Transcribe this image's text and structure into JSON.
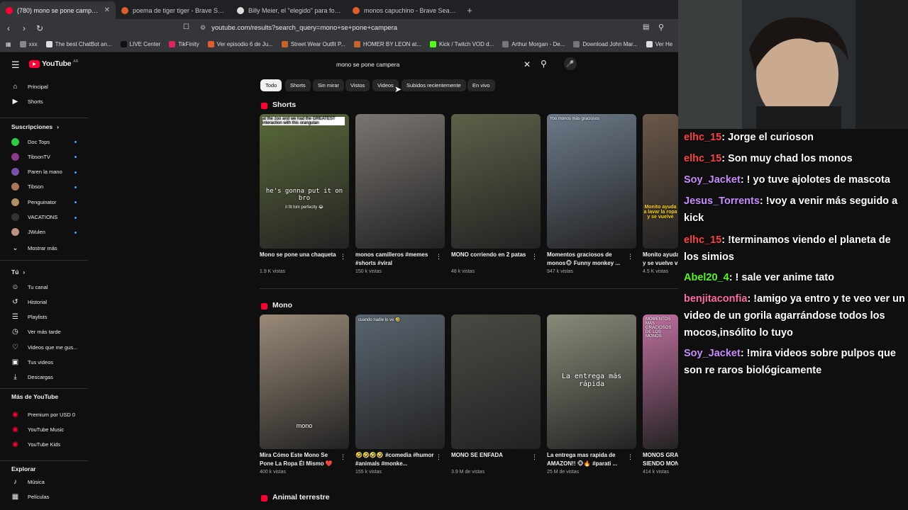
{
  "browser": {
    "tabs": [
      {
        "label": "(780) mono se pone campera - Y",
        "active": true,
        "color": "#ff0033"
      },
      {
        "label": "poema de tiger tiger - Brave Search",
        "active": false,
        "color": "#e25b2b"
      },
      {
        "label": "Billy Meier, el \"elegido\" para fotografi",
        "active": false,
        "color": "#dddddd"
      },
      {
        "label": "monos capuchino - Brave Search",
        "active": false,
        "color": "#e25b2b"
      }
    ],
    "url": "youtube.com/results?search_query=mono+se+pone+campera",
    "bookmarks": [
      {
        "label": "xxx",
        "color": "#888888"
      },
      {
        "label": "The best ChatBot an...",
        "color": "#dddddd"
      },
      {
        "label": "LIVE Center",
        "color": "#111111"
      },
      {
        "label": "TikFinity",
        "color": "#e0245e"
      },
      {
        "label": "Ver episodio 6 de Ju...",
        "color": "#e25b2b"
      },
      {
        "label": "Street Wear Outfit P...",
        "color": "#c8642a"
      },
      {
        "label": "HOMER BY LEON at...",
        "color": "#c8642a"
      },
      {
        "label": "Kick / Twitch VOD d...",
        "color": "#53fc18"
      },
      {
        "label": "Arthur Morgan - De...",
        "color": "#777777"
      },
      {
        "label": "Download John Mar...",
        "color": "#777777"
      },
      {
        "label": "Ver He",
        "color": "#dddddd"
      }
    ]
  },
  "youtube": {
    "logo": "YouTube",
    "logo_sup": "AR",
    "search_value": "mono se pone campera",
    "sidebar": {
      "main": [
        {
          "label": "Principal",
          "icon": "home-icon"
        },
        {
          "label": "Shorts",
          "icon": "shorts-icon"
        }
      ],
      "subs_heading": "Suscripciones",
      "subs": [
        {
          "label": "Doc Tops",
          "color": "#2ecc40"
        },
        {
          "label": "TibsonTV",
          "color": "#8b3a8b"
        },
        {
          "label": "Paren la mano",
          "color": "#7b4fb0"
        },
        {
          "label": "Tibson",
          "color": "#aa7755"
        },
        {
          "label": "Penguinator",
          "color": "#b09060"
        },
        {
          "label": "VACATIONS",
          "color": "#333333"
        },
        {
          "label": "JWulen",
          "color": "#c09080"
        }
      ],
      "show_more": "Mostrar más",
      "you_heading": "Tú",
      "you": [
        {
          "label": "Tu canal",
          "icon": "channel-icon"
        },
        {
          "label": "Historial",
          "icon": "history-icon"
        },
        {
          "label": "Playlists",
          "icon": "playlists-icon"
        },
        {
          "label": "Ver más tarde",
          "icon": "watch-later-icon"
        },
        {
          "label": "Videos que me gus...",
          "icon": "like-icon"
        },
        {
          "label": "Tus videos",
          "icon": "your-videos-icon"
        },
        {
          "label": "Descargas",
          "icon": "download-icon"
        }
      ],
      "more_heading": "Más de YouTube",
      "more": [
        {
          "label": "Premium por USD 0",
          "color": "#ff0033"
        },
        {
          "label": "YouTube Music",
          "color": "#ff0033"
        },
        {
          "label": "YouTube Kids",
          "color": "#ff0033"
        }
      ],
      "explore_heading": "Explorar",
      "explore": [
        {
          "label": "Música",
          "icon": "music-icon"
        },
        {
          "label": "Películas",
          "icon": "movies-icon"
        }
      ]
    },
    "chips": [
      "Todo",
      "Shorts",
      "Sin mirar",
      "Vistos",
      "Videos",
      "Subidos recientemente",
      "En vivo"
    ],
    "sections": [
      {
        "title": "Shorts",
        "items": [
          {
            "title": "Mono se pone una chaqueta",
            "views": "1.9 K vistas",
            "top_text": "at the zoo and we had the GREATEST interaction with this orangutan",
            "mid_text": "he's gonna put it on bro",
            "low_text": "it fit him perfectly 😂",
            "bg": "#5a6a3a"
          },
          {
            "title": "monos camilleros #memes #shorts #viral",
            "views": "150 k vistas",
            "top_text": "",
            "mid_text": "",
            "low_text": "",
            "bg": "#7a7570"
          },
          {
            "title": "MONO corriendo en 2 patas",
            "views": "48 k vistas",
            "top_text": "",
            "mid_text": "",
            "low_text": "",
            "bg": "#5d6148"
          },
          {
            "title": "Momentos graciosos de monos🐵 Funny monkey ...",
            "views": "947 k vistas",
            "top_text": "Yoo monos más graciosos",
            "mid_text": "",
            "low_text": "",
            "bg": "#6d7a8a"
          },
          {
            "title": "Monito ayuda a lavar la ropa y se vuelve viral",
            "views": "4.5 K vistas",
            "top_text": "",
            "mid_text": "",
            "low_text": "Monito ayuda a lavar la ropa y se vuelve",
            "bg": "#6b5848"
          }
        ]
      },
      {
        "title": "Mono",
        "items": [
          {
            "title": "Mira Cómo Este Mono Se Pone La Ropa Él Mismo ❤️",
            "views": "400 k vistas",
            "top_text": "",
            "mid_text": "",
            "low_text": "mono",
            "bg": "#9a8a78"
          },
          {
            "title": "🤣🤣🤣🤣 #comedia #humor #animals #monke...",
            "views": "155 k vistas",
            "top_text": "cuando nadie lo ve 🤣",
            "mid_text": "",
            "low_text": "",
            "bg": "#5a6570"
          },
          {
            "title": "MONO SE ENFADA",
            "views": "3.9 M de vistas",
            "top_text": "",
            "mid_text": "",
            "low_text": "",
            "bg": "#4a4a44"
          },
          {
            "title": "La entrega mas rapida de AMAZON!! 🐵🔥 #parati ...",
            "views": "25 M de vistas",
            "top_text": "",
            "mid_text": "La entrega más rápida",
            "low_text": "",
            "bg": "#8a8a7a"
          },
          {
            "title": "MONOS GRACIOSOS SIENDO MONOS",
            "views": "414 k vistas",
            "top_text": "MOMENTOS MAS GRACIOSOS DE LOS MONOS",
            "mid_text": "",
            "low_text": "",
            "bg": "#c070a0"
          }
        ]
      }
    ],
    "third_section": "Animal terrestre"
  },
  "chat": [
    {
      "user": "elhc_15",
      "text": ": Jorge el curioson",
      "color": "#ff4040"
    },
    {
      "user": "elhc_15",
      "text": ": Son muy chad los monos",
      "color": "#ff4040"
    },
    {
      "user": "Soy_Jacket",
      "text": ": ! yo tuve ajolotes de mascota",
      "color": "#c98cff"
    },
    {
      "user": "Jesus_Torrents",
      "text": ": !voy a venir más seguido a kick",
      "color": "#c98cff"
    },
    {
      "user": "elhc_15",
      "text": ": !terminamos viendo el planeta de los simios",
      "color": "#ff4040"
    },
    {
      "user": "Abel20_4",
      "text": ": ! sale ver anime tato",
      "color": "#53fc18"
    },
    {
      "user": "benjitaconfia",
      "text": ": !amigo ya entro y te veo ver un video de un gorila agarrándose todos los mocos,insólito lo tuyo",
      "color": "#ff6aa8"
    },
    {
      "user": "Soy_Jacket",
      "text": ": !mira videos sobre pulpos que son re raros biológicamente",
      "color": "#c98cff"
    }
  ]
}
